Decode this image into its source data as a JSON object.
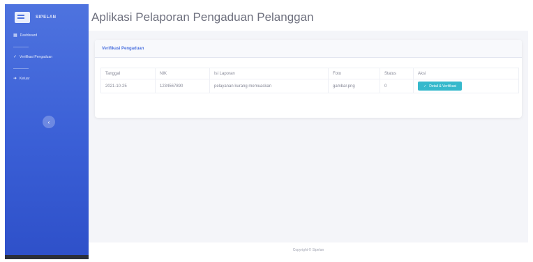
{
  "sidebar": {
    "brand": "SIPELAN",
    "items": [
      {
        "label": "Dashboard",
        "icon": "dashboard-icon"
      },
      {
        "label": "Verifikasi Pengaduan",
        "icon": "check-icon"
      },
      {
        "label": "Keluar",
        "icon": "logout-icon"
      }
    ],
    "toggle_icon": "‹"
  },
  "header": {
    "title": "Aplikasi Pelaporan Pengaduan Pelanggan"
  },
  "card": {
    "title": "Verifikasi Pengaduan",
    "table": {
      "columns": [
        "Tanggal",
        "NIK",
        "Isi Laporan",
        "Foto",
        "Status",
        "Aksi"
      ],
      "rows": [
        {
          "tanggal": "2021-10-25",
          "nik": "1234567890",
          "isi": "pelayanan kurang memuaskan",
          "foto": "gambar.png",
          "status": "0",
          "aksi": "Detail & Verifikasi"
        }
      ]
    }
  },
  "footer": {
    "text": "Copyright © Sipelan"
  },
  "colors": {
    "primary": "#4e73df",
    "info": "#36b9cc"
  }
}
